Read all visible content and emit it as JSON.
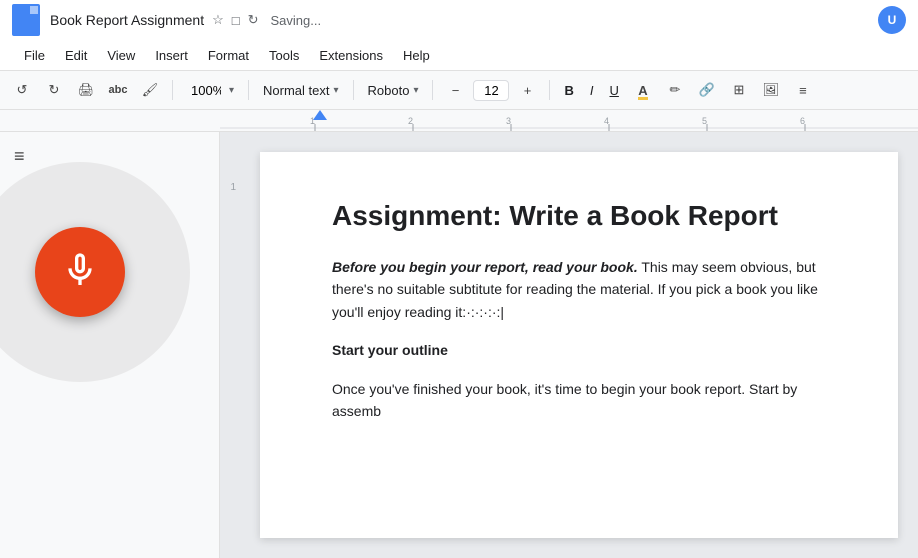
{
  "titleBar": {
    "appName": "Book Report Assignment",
    "savingText": "Saving...",
    "starIcon": "★",
    "driveIcon": "□",
    "historyIcon": "↺"
  },
  "menuBar": {
    "items": [
      "File",
      "Edit",
      "View",
      "Insert",
      "Format",
      "Tools",
      "Extensions",
      "Help"
    ]
  },
  "toolbar": {
    "undoLabel": "↺",
    "redoLabel": "↻",
    "printLabel": "🖨",
    "spellcheckLabel": "abc",
    "paintLabel": "🖌",
    "zoomValue": "100%",
    "zoomPlaceholder": "100%",
    "textStyleLabel": "Normal text",
    "fontLabel": "Roboto",
    "fontSizeValue": "12",
    "boldLabel": "B",
    "italicLabel": "I",
    "underlineLabel": "U",
    "textColorLabel": "A",
    "highlightLabel": "✏",
    "linkLabel": "🔗",
    "tableLabel": "⊞",
    "imageLabel": "🖼",
    "moreLabel": "≡"
  },
  "document": {
    "title": "Assignment: Write a Book Report",
    "paragraph1BoldItalic": "Before you begin your report, read your book.",
    "paragraph1Rest": " This may seem obvious, but there's no suitable subtitute for reading the material. If you pick a book you like you'll enjoy reading it:·:·:·:·:|",
    "section2Title": "Start your outline",
    "paragraph2": "Once you've finished your book, it's time to begin your book report. Start by assemb"
  },
  "sidebar": {
    "outlineIcon": "≡"
  },
  "colors": {
    "accent": "#4285f4",
    "micBackground": "#e8441a",
    "docBackground": "#e8eaed"
  }
}
